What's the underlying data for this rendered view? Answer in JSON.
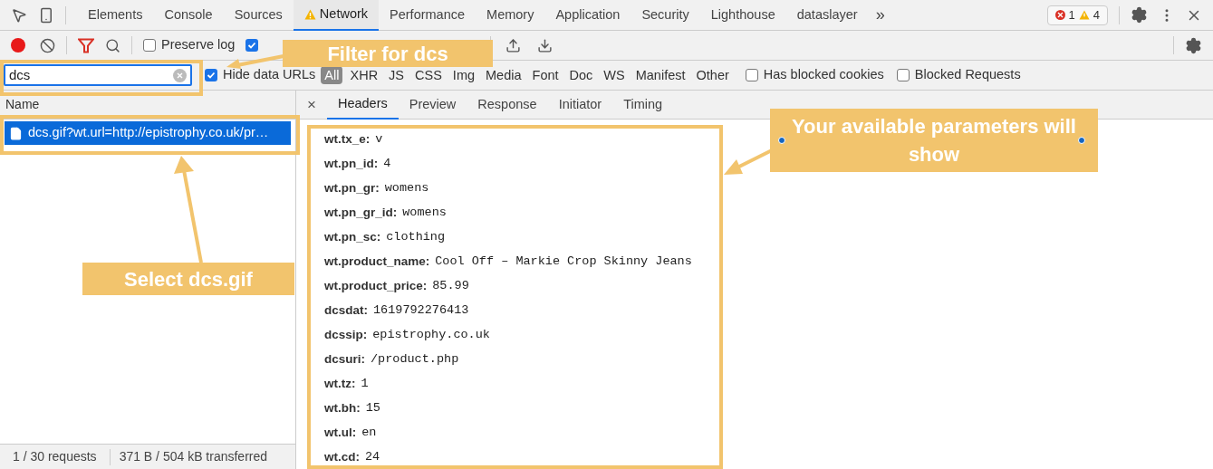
{
  "tabs": [
    {
      "label": "Elements",
      "selected": false,
      "warning": false
    },
    {
      "label": "Console",
      "selected": false,
      "warning": false
    },
    {
      "label": "Sources",
      "selected": false,
      "warning": false
    },
    {
      "label": "Network",
      "selected": true,
      "warning": true
    },
    {
      "label": "Performance",
      "selected": false,
      "warning": false
    },
    {
      "label": "Memory",
      "selected": false,
      "warning": false
    },
    {
      "label": "Application",
      "selected": false,
      "warning": false
    },
    {
      "label": "Security",
      "selected": false,
      "warning": false
    },
    {
      "label": "Lighthouse",
      "selected": false,
      "warning": false
    },
    {
      "label": "dataslayer",
      "selected": false,
      "warning": false
    }
  ],
  "more_tabs": "»",
  "issues": {
    "errors": "1",
    "warnings": "4"
  },
  "toolbar": {
    "recording": true,
    "preserve_log": {
      "label": "Preserve log",
      "checked": false
    },
    "disable_cache": {
      "checked": true
    }
  },
  "filter": {
    "value": "dcs",
    "hide_data_urls": {
      "label": "Hide data URLs",
      "checked": true
    },
    "types": [
      {
        "label": "All",
        "selected": true
      },
      {
        "label": "XHR",
        "selected": false
      },
      {
        "label": "JS",
        "selected": false
      },
      {
        "label": "CSS",
        "selected": false
      },
      {
        "label": "Img",
        "selected": false
      },
      {
        "label": "Media",
        "selected": false
      },
      {
        "label": "Font",
        "selected": false
      },
      {
        "label": "Doc",
        "selected": false
      },
      {
        "label": "WS",
        "selected": false
      },
      {
        "label": "Manifest",
        "selected": false
      },
      {
        "label": "Other",
        "selected": false
      }
    ],
    "options": [
      {
        "label": "Has blocked cookies",
        "checked": false
      },
      {
        "label": "Blocked Requests",
        "checked": false
      }
    ]
  },
  "requests": {
    "column": "Name",
    "rows": [
      {
        "name": "dcs.gif?wt.url=http://epistrophy.co.uk/pr…",
        "selected": true
      }
    ]
  },
  "status_bar": [
    "1 / 30 requests",
    "371 B / 504 kB transferred"
  ],
  "details": {
    "close": "×",
    "tabs": [
      {
        "label": "Headers",
        "selected": true
      },
      {
        "label": "Preview",
        "selected": false
      },
      {
        "label": "Response",
        "selected": false
      },
      {
        "label": "Initiator",
        "selected": false
      },
      {
        "label": "Timing",
        "selected": false
      }
    ],
    "params": [
      {
        "key": "wt.tx_e:",
        "value": "v"
      },
      {
        "key": "wt.pn_id:",
        "value": "4"
      },
      {
        "key": "wt.pn_gr:",
        "value": "womens"
      },
      {
        "key": "wt.pn_gr_id:",
        "value": "womens"
      },
      {
        "key": "wt.pn_sc:",
        "value": "clothing"
      },
      {
        "key": "wt.product_name:",
        "value": "Cool Off – Markie Crop Skinny Jeans"
      },
      {
        "key": "wt.product_price:",
        "value": "85.99"
      },
      {
        "key": "dcsdat:",
        "value": "1619792276413"
      },
      {
        "key": "dcssip:",
        "value": "epistrophy.co.uk"
      },
      {
        "key": "dcsuri:",
        "value": "/product.php"
      },
      {
        "key": "wt.tz:",
        "value": "1"
      },
      {
        "key": "wt.bh:",
        "value": "15"
      },
      {
        "key": "wt.ul:",
        "value": "en"
      },
      {
        "key": "wt.cd:",
        "value": "24"
      }
    ]
  },
  "annotations": [
    {
      "kind": "filter",
      "text": "Filter for dcs"
    },
    {
      "kind": "select",
      "text": "Select dcs.gif"
    },
    {
      "kind": "params",
      "text": "Your available parameters will show"
    }
  ]
}
